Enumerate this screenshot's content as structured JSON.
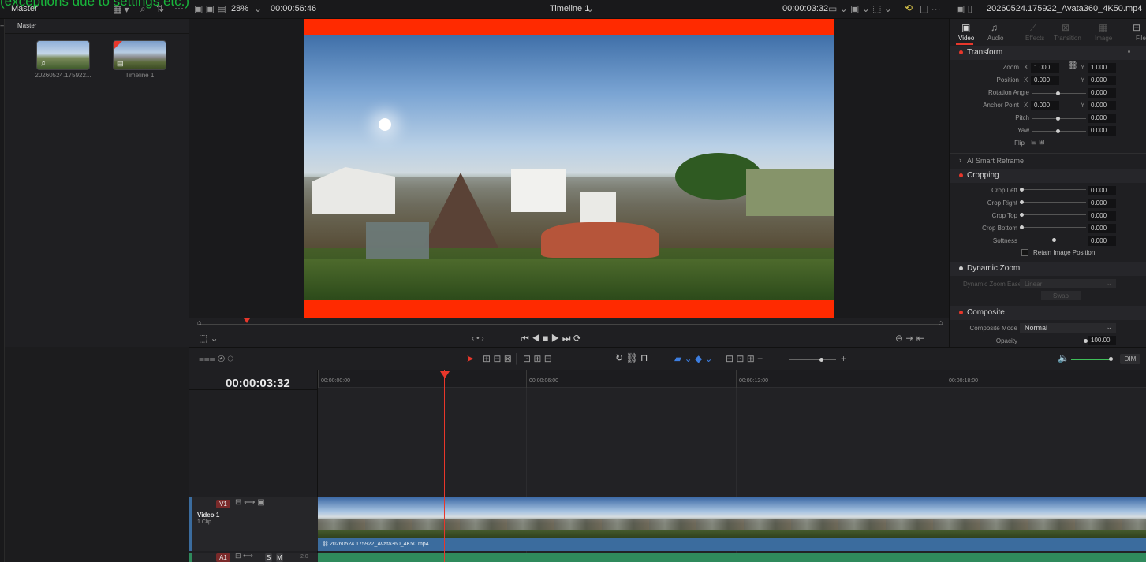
{
  "overlay_note": "(exceptions due to settings etc.)",
  "topbar": {
    "pool_title": "Master",
    "zoom": "28%",
    "source_timecode": "00:00:56:46",
    "timeline_name": "Timeline 1",
    "record_timecode": "00:00:03:32",
    "clip_filename": "20260524.175922_Avata360_4K50.mp4"
  },
  "media_pool": {
    "folder": "Master",
    "items": [
      {
        "label": "20260524.175922..."
      },
      {
        "label": "Timeline 1"
      }
    ]
  },
  "inspector": {
    "tabs": [
      "Video",
      "Audio",
      "Effects",
      "Transition",
      "Image",
      "File"
    ],
    "transform": {
      "title": "Transform",
      "zoom_label": "Zoom",
      "zoom_x": "1.000",
      "zoom_y": "1.000",
      "position_label": "Position",
      "position_x": "0.000",
      "position_y": "0.000",
      "rotation_label": "Rotation Angle",
      "rotation": "0.000",
      "anchor_label": "Anchor Point",
      "anchor_x": "0.000",
      "anchor_y": "0.000",
      "pitch_label": "Pitch",
      "pitch": "0.000",
      "yaw_label": "Yaw",
      "yaw": "0.000",
      "flip_label": "Flip"
    },
    "ai_reframe": "AI Smart Reframe",
    "cropping": {
      "title": "Cropping",
      "left_label": "Crop Left",
      "left": "0.000",
      "right_label": "Crop Right",
      "right": "0.000",
      "top_label": "Crop Top",
      "top": "0.000",
      "bottom_label": "Crop Bottom",
      "bottom": "0.000",
      "soft_label": "Softness",
      "soft": "0.000",
      "retain": "Retain Image Position"
    },
    "dynamic_zoom": {
      "title": "Dynamic Zoom",
      "ease_label": "Dynamic Zoom Ease",
      "ease": "Linear",
      "swap": "Swap"
    },
    "composite": {
      "title": "Composite",
      "mode_label": "Composite Mode",
      "mode": "Normal",
      "opacity_label": "Opacity",
      "opacity": "100.00"
    }
  },
  "timeline": {
    "timecode": "00:00:03:32",
    "ruler": [
      "00:00:00:00",
      "00:00:06:00",
      "00:00:12:00",
      "00:00:18:00"
    ],
    "video_track": {
      "badge": "V1",
      "name": "Video 1",
      "count": "1 Clip"
    },
    "audio_track": {
      "badge": "A1",
      "solo": "S",
      "mute": "M",
      "channels": "2.0"
    },
    "clip_name": "20260524.175922_Avata360_4K50.mp4",
    "dim_label": "DIM"
  },
  "colors": {
    "accent_red": "#e8372b",
    "clip_blue": "#3b6c9e",
    "audio_green": "#2f8a5c",
    "frame_red": "#ff2a00"
  }
}
